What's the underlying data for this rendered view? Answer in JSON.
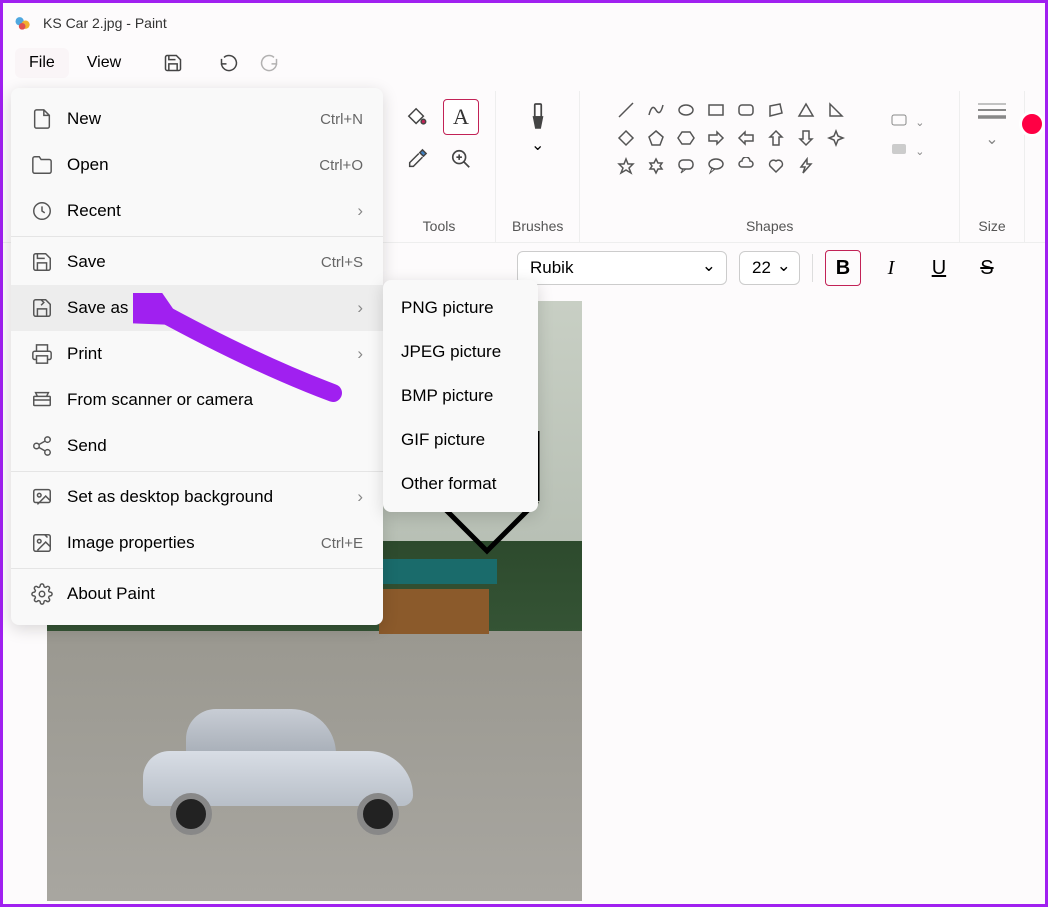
{
  "title": "KS Car 2.jpg - Paint",
  "menu": {
    "file": "File",
    "view": "View"
  },
  "ribbon": {
    "tools": "Tools",
    "brushes": "Brushes",
    "shapes": "Shapes",
    "size": "Size"
  },
  "textbar": {
    "font": "Rubik",
    "size": "22"
  },
  "fileMenu": {
    "new": {
      "label": "New",
      "shortcut": "Ctrl+N"
    },
    "open": {
      "label": "Open",
      "shortcut": "Ctrl+O"
    },
    "recent": {
      "label": "Recent"
    },
    "save": {
      "label": "Save",
      "shortcut": "Ctrl+S"
    },
    "saveAs": {
      "label": "Save as"
    },
    "print": {
      "label": "Print"
    },
    "scanner": {
      "label": "From scanner or camera"
    },
    "send": {
      "label": "Send"
    },
    "wallpaper": {
      "label": "Set as desktop background"
    },
    "props": {
      "label": "Image properties",
      "shortcut": "Ctrl+E"
    },
    "about": {
      "label": "About Paint"
    }
  },
  "saveAsSub": {
    "png": "PNG picture",
    "jpeg": "JPEG picture",
    "bmp": "BMP picture",
    "gif": "GIF picture",
    "other": "Other format"
  }
}
